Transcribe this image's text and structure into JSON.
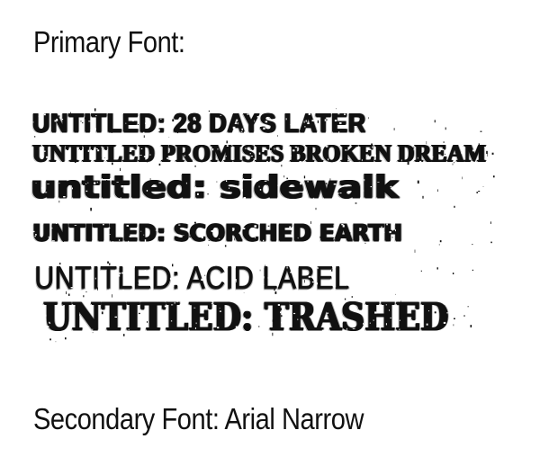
{
  "primary_heading": "Primary Font:",
  "font_samples": [
    "Untitled: 28 Days Later",
    "Untitled Promises Broken dream",
    "untitled: sidewalk",
    "UNTITLED: SCORCHED EARTH",
    "UNTITLED: ACID LABEL",
    "UNTITLED: TRASHED"
  ],
  "secondary_heading": "Secondary Font: Arial Narrow",
  "colors": {
    "background": "#ffffff",
    "text": "#111111"
  }
}
